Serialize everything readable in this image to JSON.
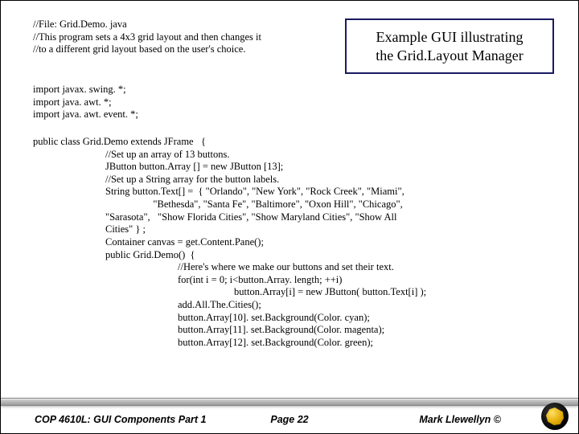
{
  "intro": {
    "line1": "//File:  Grid.Demo. java",
    "line2": "//This program sets a 4x3 grid layout and then changes it",
    "line3": "//to a different grid layout based on the user's choice."
  },
  "callout": {
    "line1": "Example GUI illustrating",
    "line2": "the Grid.Layout Manager"
  },
  "imports": {
    "l1": "import javax. swing. *;",
    "l2": "import java. awt. *;",
    "l3": "import java. awt. event. *;"
  },
  "code": {
    "decl": "public class Grid.Demo extends JFrame   {",
    "c1": "//Set up an array of 13 buttons.",
    "c2": "JButton button.Array [] = new JButton [13];",
    "c3": "//Set up a String array for the button labels.",
    "c4": "String button.Text[] =  { \"Orlando\", \"New York\", \"Rock Creek\", \"Miami\",",
    "c5": "                   \"Bethesda\", \"Santa Fe\", \"Baltimore\", \"Oxon Hill\", \"Chicago\",",
    "c6": "\"Sarasota\",   \"Show Florida Cities\", \"Show Maryland Cities\", \"Show All",
    "c7": "Cities\" } ;",
    "c8": "Container canvas = get.Content.Pane();",
    "c9": "public Grid.Demo()  {",
    "c10": "//Here's where we make our buttons and set their text.",
    "c11": "for(int i = 0; i<button.Array. length; ++i)",
    "c12": "button.Array[i] = new JButton( button.Text[i] );",
    "c13": "add.All.The.Cities();",
    "c14": "button.Array[10]. set.Background(Color. cyan);",
    "c15": "button.Array[11]. set.Background(Color. magenta);",
    "c16": "button.Array[12]. set.Background(Color. green);"
  },
  "footer": {
    "left": "COP 4610L: GUI Components Part 1",
    "center": "Page 22",
    "right": "Mark Llewellyn ©"
  }
}
